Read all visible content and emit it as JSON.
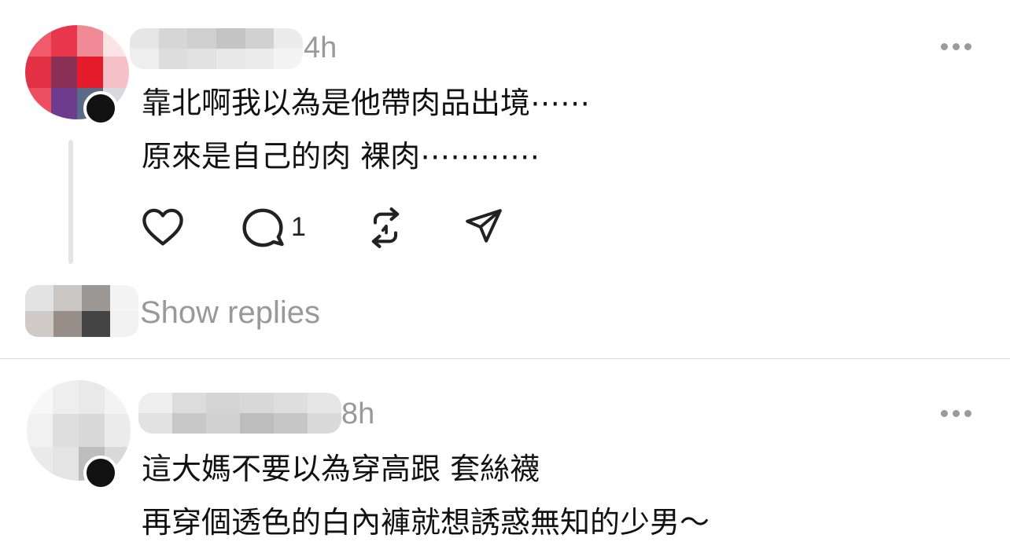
{
  "posts": [
    {
      "time": "4h",
      "lines": [
        "靠北啊我以為是他帶肉品出境⋯⋯",
        "原來是自己的肉 裸肉⋯⋯⋯⋯"
      ],
      "reply_count": "1",
      "show_replies": "Show replies"
    },
    {
      "time": "8h",
      "lines": [
        "這大媽不要以為穿高跟 套絲襪",
        "再穿個透色的白內褲就想誘惑無知的少男～"
      ]
    }
  ],
  "icons": {
    "like": "heart-icon",
    "reply": "comment-icon",
    "repost": "repost-icon",
    "share": "send-icon",
    "more": "more-icon"
  },
  "colors": {
    "secondary_text": "#999999",
    "divider": "#dcdcdc",
    "thread_line": "#e5e5e5"
  }
}
